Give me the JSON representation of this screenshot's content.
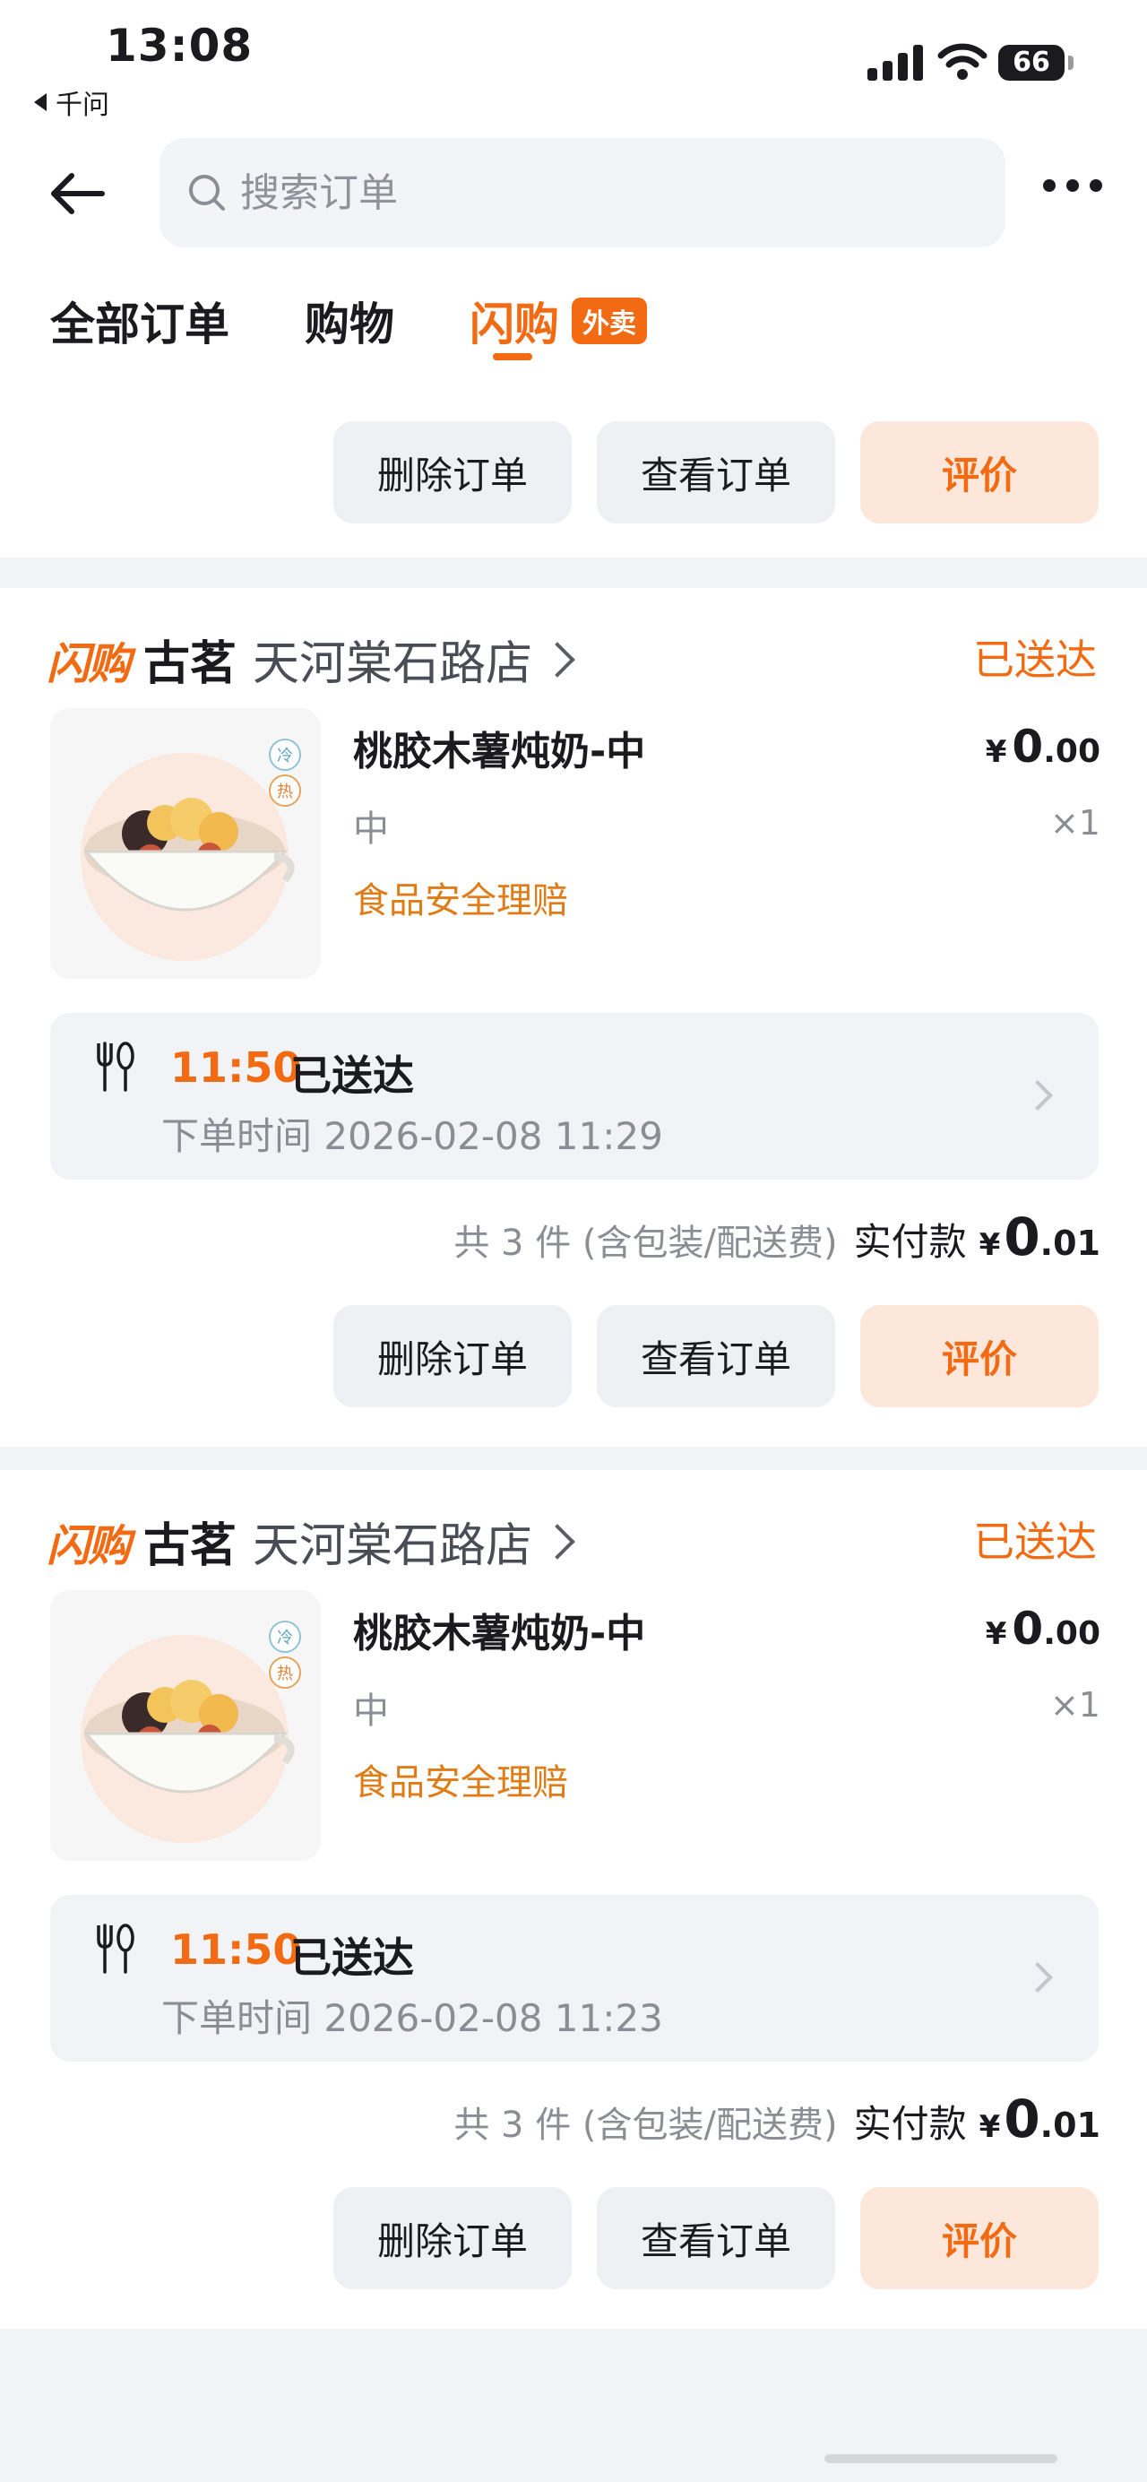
{
  "status_bar": {
    "time": "13:08",
    "back_app": "千问",
    "battery": "66"
  },
  "search": {
    "placeholder": "搜索订单"
  },
  "tabs": [
    {
      "label": "全部订单"
    },
    {
      "label": "购物"
    },
    {
      "label": "闪购",
      "badge": "外卖",
      "active": true
    }
  ],
  "buttons": {
    "delete": "删除订单",
    "view": "查看订单",
    "review": "评价"
  },
  "orders": [
    {
      "brand": "闪购",
      "shop": "古茗",
      "branch": "天河棠石路店",
      "status": "已送达",
      "product": "桃胶木薯炖奶-中",
      "temp_tags": [
        "冷",
        "热"
      ],
      "price_symbol": "¥",
      "price_int": "0",
      "price_dec": ".00",
      "spec": "中",
      "qty": "×1",
      "guarantee": "食品安全理赔",
      "delivered_time": "11:50",
      "delivered_status": "已送达",
      "order_time": "下单时间 2026-02-08 11:29",
      "count_text": "共 3 件 (含包装/配送费)",
      "paid_label": "实付款",
      "paid_symbol": "¥",
      "paid_int": "0",
      "paid_dec": ".01"
    },
    {
      "brand": "闪购",
      "shop": "古茗",
      "branch": "天河棠石路店",
      "status": "已送达",
      "product": "桃胶木薯炖奶-中",
      "temp_tags": [
        "冷",
        "热"
      ],
      "price_symbol": "¥",
      "price_int": "0",
      "price_dec": ".00",
      "spec": "中",
      "qty": "×1",
      "guarantee": "食品安全理赔",
      "delivered_time": "11:50",
      "delivered_status": "已送达",
      "order_time": "下单时间 2026-02-08 11:23",
      "count_text": "共 3 件 (含包装/配送费)",
      "paid_label": "实付款",
      "paid_symbol": "¥",
      "paid_int": "0",
      "paid_dec": ".01"
    }
  ]
}
